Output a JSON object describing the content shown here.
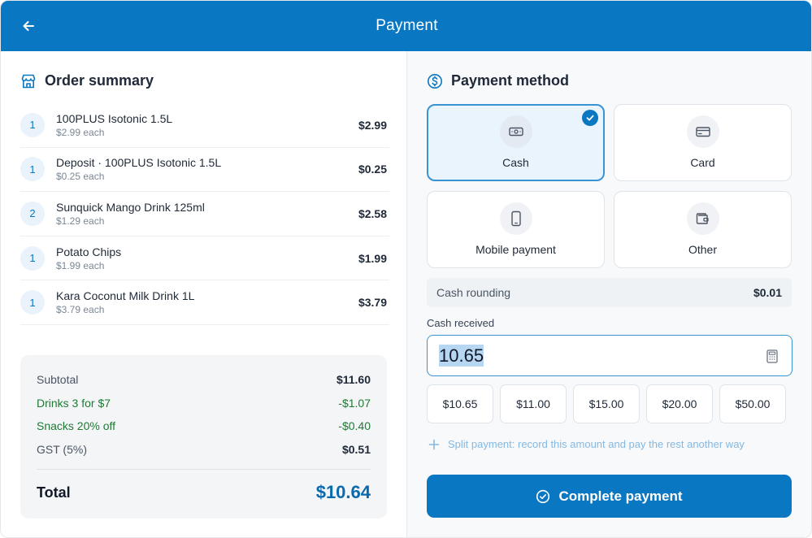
{
  "header": {
    "title": "Payment",
    "back_icon": "arrow-left-icon"
  },
  "order_summary": {
    "title": "Order summary",
    "icon": "store-icon",
    "items": [
      {
        "qty": "1",
        "name": "100PLUS Isotonic 1.5L",
        "each": "$2.99 each",
        "price": "$2.99"
      },
      {
        "qty": "1",
        "name": "Deposit · 100PLUS Isotonic 1.5L",
        "each": "$0.25 each",
        "price": "$0.25"
      },
      {
        "qty": "2",
        "name": "Sunquick Mango Drink 125ml",
        "each": "$1.29 each",
        "price": "$2.58"
      },
      {
        "qty": "1",
        "name": "Potato Chips",
        "each": "$1.99 each",
        "price": "$1.99"
      },
      {
        "qty": "1",
        "name": "Kara Coconut Milk Drink 1L",
        "each": "$3.79 each",
        "price": "$3.79"
      }
    ],
    "totals": {
      "subtotal_label": "Subtotal",
      "subtotal": "$11.60",
      "discount1_label": "Drinks 3 for $7",
      "discount1": "-$1.07",
      "discount2_label": "Snacks 20% off",
      "discount2": "-$0.40",
      "gst_label": "GST (5%)",
      "gst": "$0.51",
      "total_label": "Total",
      "total": "$10.64"
    }
  },
  "payment": {
    "title": "Payment method",
    "icon": "dollar-circle-icon",
    "methods": [
      {
        "label": "Cash",
        "icon": "cash-icon",
        "selected": true
      },
      {
        "label": "Card",
        "icon": "card-icon",
        "selected": false
      },
      {
        "label": "Mobile payment",
        "icon": "mobile-icon",
        "selected": false
      },
      {
        "label": "Other",
        "icon": "wallet-icon",
        "selected": false
      }
    ],
    "rounding_label": "Cash rounding",
    "rounding_value": "$0.01",
    "cash_received_label": "Cash received",
    "cash_received_value": "10.65",
    "quick_amounts": [
      "$10.65",
      "$11.00",
      "$15.00",
      "$20.00",
      "$50.00"
    ],
    "split_text": "Split payment: record this amount and pay the rest another way",
    "complete_label": "Complete payment"
  },
  "colors": {
    "primary": "#0a77c2",
    "discount": "#1e7a34",
    "total": "#0a6aad"
  }
}
